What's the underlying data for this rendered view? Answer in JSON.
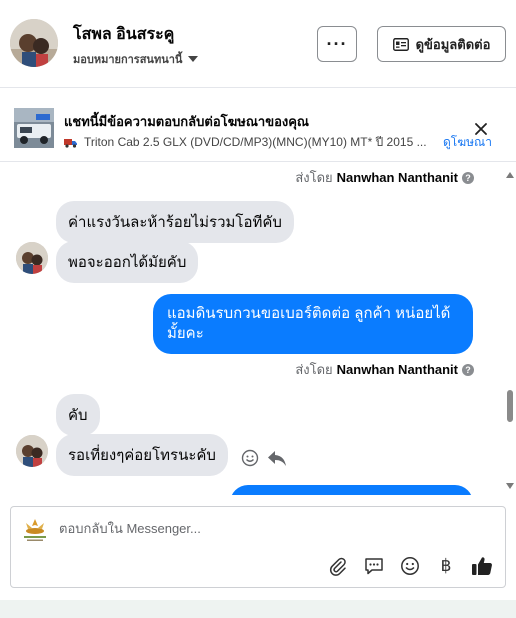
{
  "header": {
    "name": "โสพล อินสระคู",
    "assignee": "มอบหมายการสนทนานี้",
    "more_label": "···",
    "info_label": "ดูข้อมูลติดต่อ",
    "icons": {
      "more": "more-dots-icon",
      "info": "contact-card-icon",
      "assign": "chevron-down-icon"
    }
  },
  "ad_banner": {
    "title": "แชทนี้มีข้อความตอบกลับต่อโฆษณาของคุณ",
    "subtitle": "Triton Cab 2.5 GLX (DVD/CD/MP3)(MNC)(MY10) MT* ปี 2015 ...",
    "link": "ดูโฆษณา",
    "icons": {
      "truck": "truck-icon",
      "close": "close-icon"
    }
  },
  "chat": {
    "sent_by_prefix": "ส่งโดย",
    "sent_by_name": "Nanwhan Nanthanit",
    "messages": [
      {
        "direction": "in",
        "text": "ค่าแรงวันละห้าร้อยไม่รวมโอทีคับ"
      },
      {
        "direction": "in",
        "text": "พอจะออกได้มัยคับ"
      },
      {
        "direction": "out",
        "text": "แอมดินรบกวนขอเบอร์ติดต่อ ลูกค้า  หน่อยได้มั้ยคะ"
      },
      {
        "direction": "in",
        "text": "คับ"
      },
      {
        "direction": "in",
        "text": "รอเที่ยงๆค่อยโทรนะคับ"
      }
    ],
    "icons": {
      "react": "smiley-icon",
      "reply": "reply-arrow-icon",
      "info": "info-icon"
    }
  },
  "composer": {
    "placeholder": "ตอบกลับใน Messenger...",
    "baht": "฿",
    "icons": [
      "paperclip-icon",
      "saved-reply-icon",
      "emoji-icon",
      "baht-icon",
      "thumbs-up-icon"
    ]
  },
  "colors": {
    "accent": "#0a7cff",
    "incoming_bubble": "#e4e6eb",
    "link": "#1877f2"
  }
}
